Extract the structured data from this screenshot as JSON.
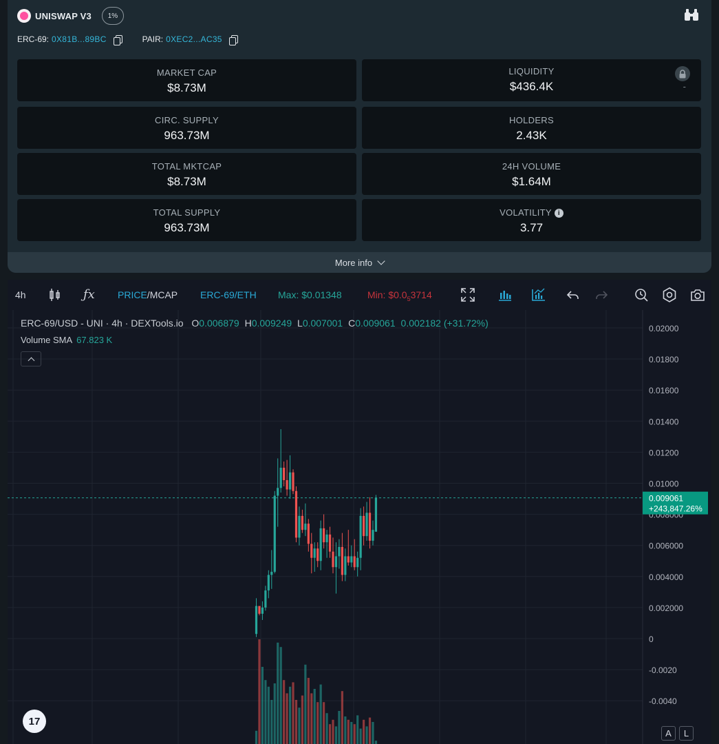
{
  "header": {
    "dex_name": "UNISWAP V3",
    "fee": "1%",
    "token_label": "ERC-69:",
    "token_address": "0X81B...89BC",
    "pair_label": "PAIR:",
    "pair_address": "0XEC2...AC35"
  },
  "stats": {
    "market_cap": {
      "label": "MARKET CAP",
      "value": "$8.73M"
    },
    "liquidity": {
      "label": "LIQUIDITY",
      "value": "$436.4K",
      "sub": "-"
    },
    "circ_supply": {
      "label": "CIRC. SUPPLY",
      "value": "963.73M"
    },
    "holders": {
      "label": "HOLDERS",
      "value": "2.43K"
    },
    "total_mktcap": {
      "label": "TOTAL MKTCAP",
      "value": "$8.73M"
    },
    "volume_24h": {
      "label": "24H VOLUME",
      "value": "$1.64M"
    },
    "total_supply": {
      "label": "TOTAL SUPPLY",
      "value": "963.73M"
    },
    "volatility": {
      "label": "VOLATILITY",
      "value": "3.77"
    }
  },
  "more_info": "More info",
  "toolbar": {
    "interval": "4h",
    "price_label": "PRICE",
    "slash": "/",
    "mcap_label": "MCAP",
    "pair_toggle": "ERC-69/ETH",
    "max": "Max: $0.01348",
    "min_prefix": "Min: $0.0",
    "min_sub": "5",
    "min_suffix": "3714"
  },
  "legend": {
    "symbol": "ERC-69/USD - UNI · 4h · DEXTools.io",
    "o_label": "O",
    "o_value": "0.006879",
    "h_label": "H",
    "h_value": "0.009249",
    "l_label": "L",
    "l_value": "0.007001",
    "c_label": "C",
    "c_value": "0.009061",
    "change": "0.002182 (+31.72%)",
    "volume_label": "Volume SMA",
    "volume_value": "67.823 K"
  },
  "price_badge": {
    "price": "0.009061",
    "change": "+243,847.26%"
  },
  "axis_buttons": {
    "auto": "A",
    "log": "L"
  },
  "tv_logo": "17",
  "colors": {
    "up": "#26a69a",
    "down": "#ef5350",
    "accent": "#2aa9d6",
    "badge": "#089981"
  },
  "chart_data": {
    "type": "candlestick",
    "y_ticks": [
      "0.02000",
      "0.01800",
      "0.01600",
      "0.01400",
      "0.01200",
      "0.01000",
      "0.008000",
      "0.006000",
      "0.004000",
      "0.002000",
      "0",
      "-0.0020",
      "-0.0040"
    ],
    "ylim": [
      -0.0052,
      0.0212
    ],
    "last_price": 0.009061,
    "candles": [
      [
        0.0003,
        0.0026,
        0.0001,
        0.0021
      ],
      [
        0.0021,
        0.002,
        0.0015,
        0.0016
      ],
      [
        0.0016,
        0.0024,
        0.0012,
        0.002
      ],
      [
        0.002,
        0.0034,
        0.0018,
        0.0031
      ],
      [
        0.0031,
        0.0044,
        0.0026,
        0.0041
      ],
      [
        0.0041,
        0.0057,
        0.0032,
        0.0043
      ],
      [
        0.0043,
        0.0095,
        0.0042,
        0.0092
      ],
      [
        0.0092,
        0.0116,
        0.0072,
        0.0097
      ],
      [
        0.0097,
        0.01348,
        0.0094,
        0.011
      ],
      [
        0.011,
        0.0114,
        0.0098,
        0.0102
      ],
      [
        0.0102,
        0.0115,
        0.0092,
        0.0096
      ],
      [
        0.0096,
        0.0118,
        0.009,
        0.0107
      ],
      [
        0.0107,
        0.0109,
        0.0093,
        0.0095
      ],
      [
        0.0095,
        0.0098,
        0.0062,
        0.0065
      ],
      [
        0.0065,
        0.0085,
        0.006,
        0.0079
      ],
      [
        0.0079,
        0.0083,
        0.0068,
        0.007
      ],
      [
        0.007,
        0.0087,
        0.0066,
        0.0074
      ],
      [
        0.0074,
        0.0077,
        0.0056,
        0.0061
      ],
      [
        0.0061,
        0.0068,
        0.0042,
        0.0052
      ],
      [
        0.0052,
        0.0062,
        0.0043,
        0.0058
      ],
      [
        0.0058,
        0.0062,
        0.0046,
        0.005
      ],
      [
        0.005,
        0.0076,
        0.0044,
        0.0071
      ],
      [
        0.0071,
        0.008,
        0.0058,
        0.0062
      ],
      [
        0.0062,
        0.007,
        0.0052,
        0.0067
      ],
      [
        0.0067,
        0.0072,
        0.0052,
        0.0056
      ],
      [
        0.0056,
        0.0065,
        0.0042,
        0.0046
      ],
      [
        0.0046,
        0.0062,
        0.0029,
        0.0053
      ],
      [
        0.0053,
        0.0064,
        0.0045,
        0.0059
      ],
      [
        0.0059,
        0.0068,
        0.0037,
        0.0041
      ],
      [
        0.0041,
        0.0058,
        0.0037,
        0.0053
      ],
      [
        0.0053,
        0.007,
        0.0047,
        0.0049
      ],
      [
        0.0049,
        0.006,
        0.0046,
        0.0053
      ],
      [
        0.0053,
        0.0064,
        0.0044,
        0.0046
      ],
      [
        0.0046,
        0.0056,
        0.004,
        0.0052
      ],
      [
        0.0052,
        0.0084,
        0.0044,
        0.0079
      ],
      [
        0.0079,
        0.0085,
        0.006,
        0.0066
      ],
      [
        0.0066,
        0.0088,
        0.0063,
        0.0081
      ],
      [
        0.0081,
        0.0091,
        0.0058,
        0.0063
      ],
      [
        0.0063,
        0.0076,
        0.006,
        0.007
      ],
      [
        0.00688,
        0.00925,
        0.007,
        0.00906
      ]
    ],
    "volumes": [
      0.12,
      0.95,
      0.7,
      0.58,
      0.52,
      0.4,
      0.55,
      0.92,
      0.88,
      0.58,
      0.46,
      0.52,
      0.56,
      0.4,
      0.33,
      0.44,
      0.72,
      0.6,
      0.46,
      0.5,
      0.38,
      0.54,
      0.38,
      0.28,
      0.18,
      0.22,
      0.16,
      0.3,
      0.48,
      0.25,
      0.22,
      0.2,
      0.18,
      0.26,
      0.14,
      0.22,
      0.16,
      0.24,
      0.2,
      0.03
    ]
  }
}
